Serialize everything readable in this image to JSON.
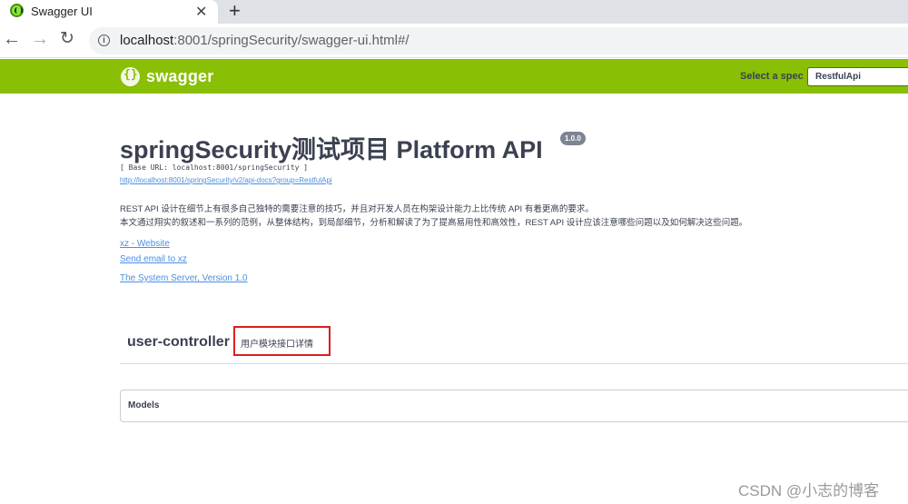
{
  "browser": {
    "tab_title": "Swagger UI",
    "tab_close": "✕",
    "new_tab": "+",
    "back": "←",
    "forward": "→",
    "reload": "↻",
    "url_host": "localhost",
    "url_rest": ":8001/springSecurity/swagger-ui.html#/",
    "icons": {
      "favicon": "swagger-favicon-icon",
      "info": "info-icon"
    }
  },
  "topbar": {
    "logo_text": "swagger",
    "spec_label": "Select a spec",
    "spec_value": "RestfulApi",
    "color": "#89bf04"
  },
  "info": {
    "title": "springSecurity测试项目 Platform API",
    "version": "1.0.0",
    "base_url": "[ Base URL: localhost:8001/springSecurity ]",
    "docs_url": "http://localhost:8001/springSecurity/v2/api-docs?group=RestfulApi",
    "description_lines": [
      "REST API 设计在细节上有很多自己独特的需要注意的技巧，并且对开发人员在构架设计能力上比传统 API 有着更高的要求。",
      "本文通过翔实的叙述和一系列的范例，从整体结构，到局部细节，分析和解读了为了提高易用性和高效性，REST API 设计应该注意哪些问题以及如何解决这些问题。"
    ],
    "links": {
      "website": "xz - Website",
      "email": "Send email to xz",
      "license": "The System Server, Version 1.0"
    }
  },
  "tag": {
    "name": "user-controller",
    "description": "用户模块接口详情",
    "highlight_color": "#d92020"
  },
  "models": {
    "title": "Models"
  },
  "watermark": "CSDN @小志的博客"
}
